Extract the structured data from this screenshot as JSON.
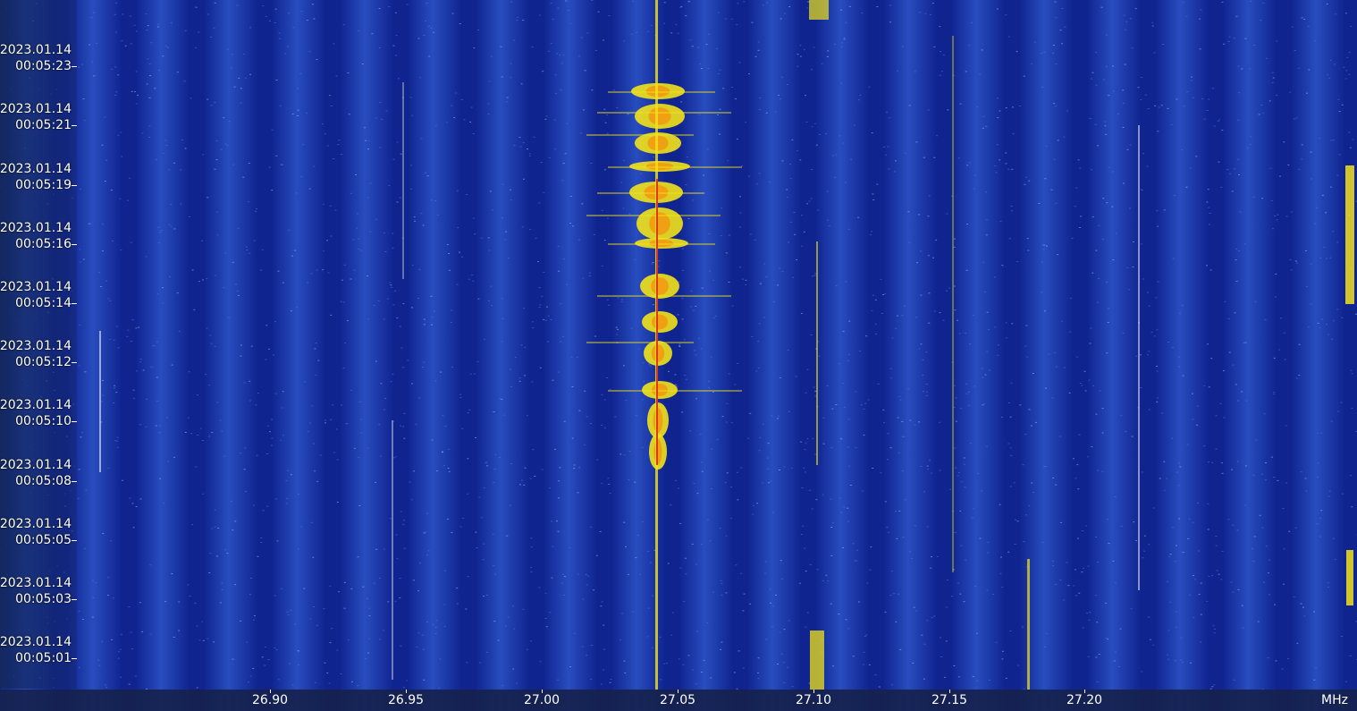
{
  "colors": {
    "background": "#10248f",
    "noise_light": "#4a7be6",
    "signal_yellow": "#f2e21a",
    "signal_orange": "#f29a12",
    "signal_red": "#d9281a",
    "axis_text": "#ffffff"
  },
  "time_axis": {
    "labels": [
      {
        "date": "2023.01.14",
        "time": "00:05:23"
      },
      {
        "date": "2023.01.14",
        "time": "00:05:21"
      },
      {
        "date": "2023.01.14",
        "time": "00:05:19"
      },
      {
        "date": "2023.01.14",
        "time": "00:05:16"
      },
      {
        "date": "2023.01.14",
        "time": "00:05:14"
      },
      {
        "date": "2023.01.14",
        "time": "00:05:12"
      },
      {
        "date": "2023.01.14",
        "time": "00:05:10"
      },
      {
        "date": "2023.01.14",
        "time": "00:05:08"
      },
      {
        "date": "2023.01.14",
        "time": "00:05:05"
      },
      {
        "date": "2023.01.14",
        "time": "00:05:03"
      },
      {
        "date": "2023.01.14",
        "time": "00:05:01"
      }
    ]
  },
  "freq_axis": {
    "labels": [
      "26.90",
      "26.95",
      "27.00",
      "27.05",
      "27.10",
      "27.15",
      "27.20"
    ],
    "unit": "MHz"
  }
}
